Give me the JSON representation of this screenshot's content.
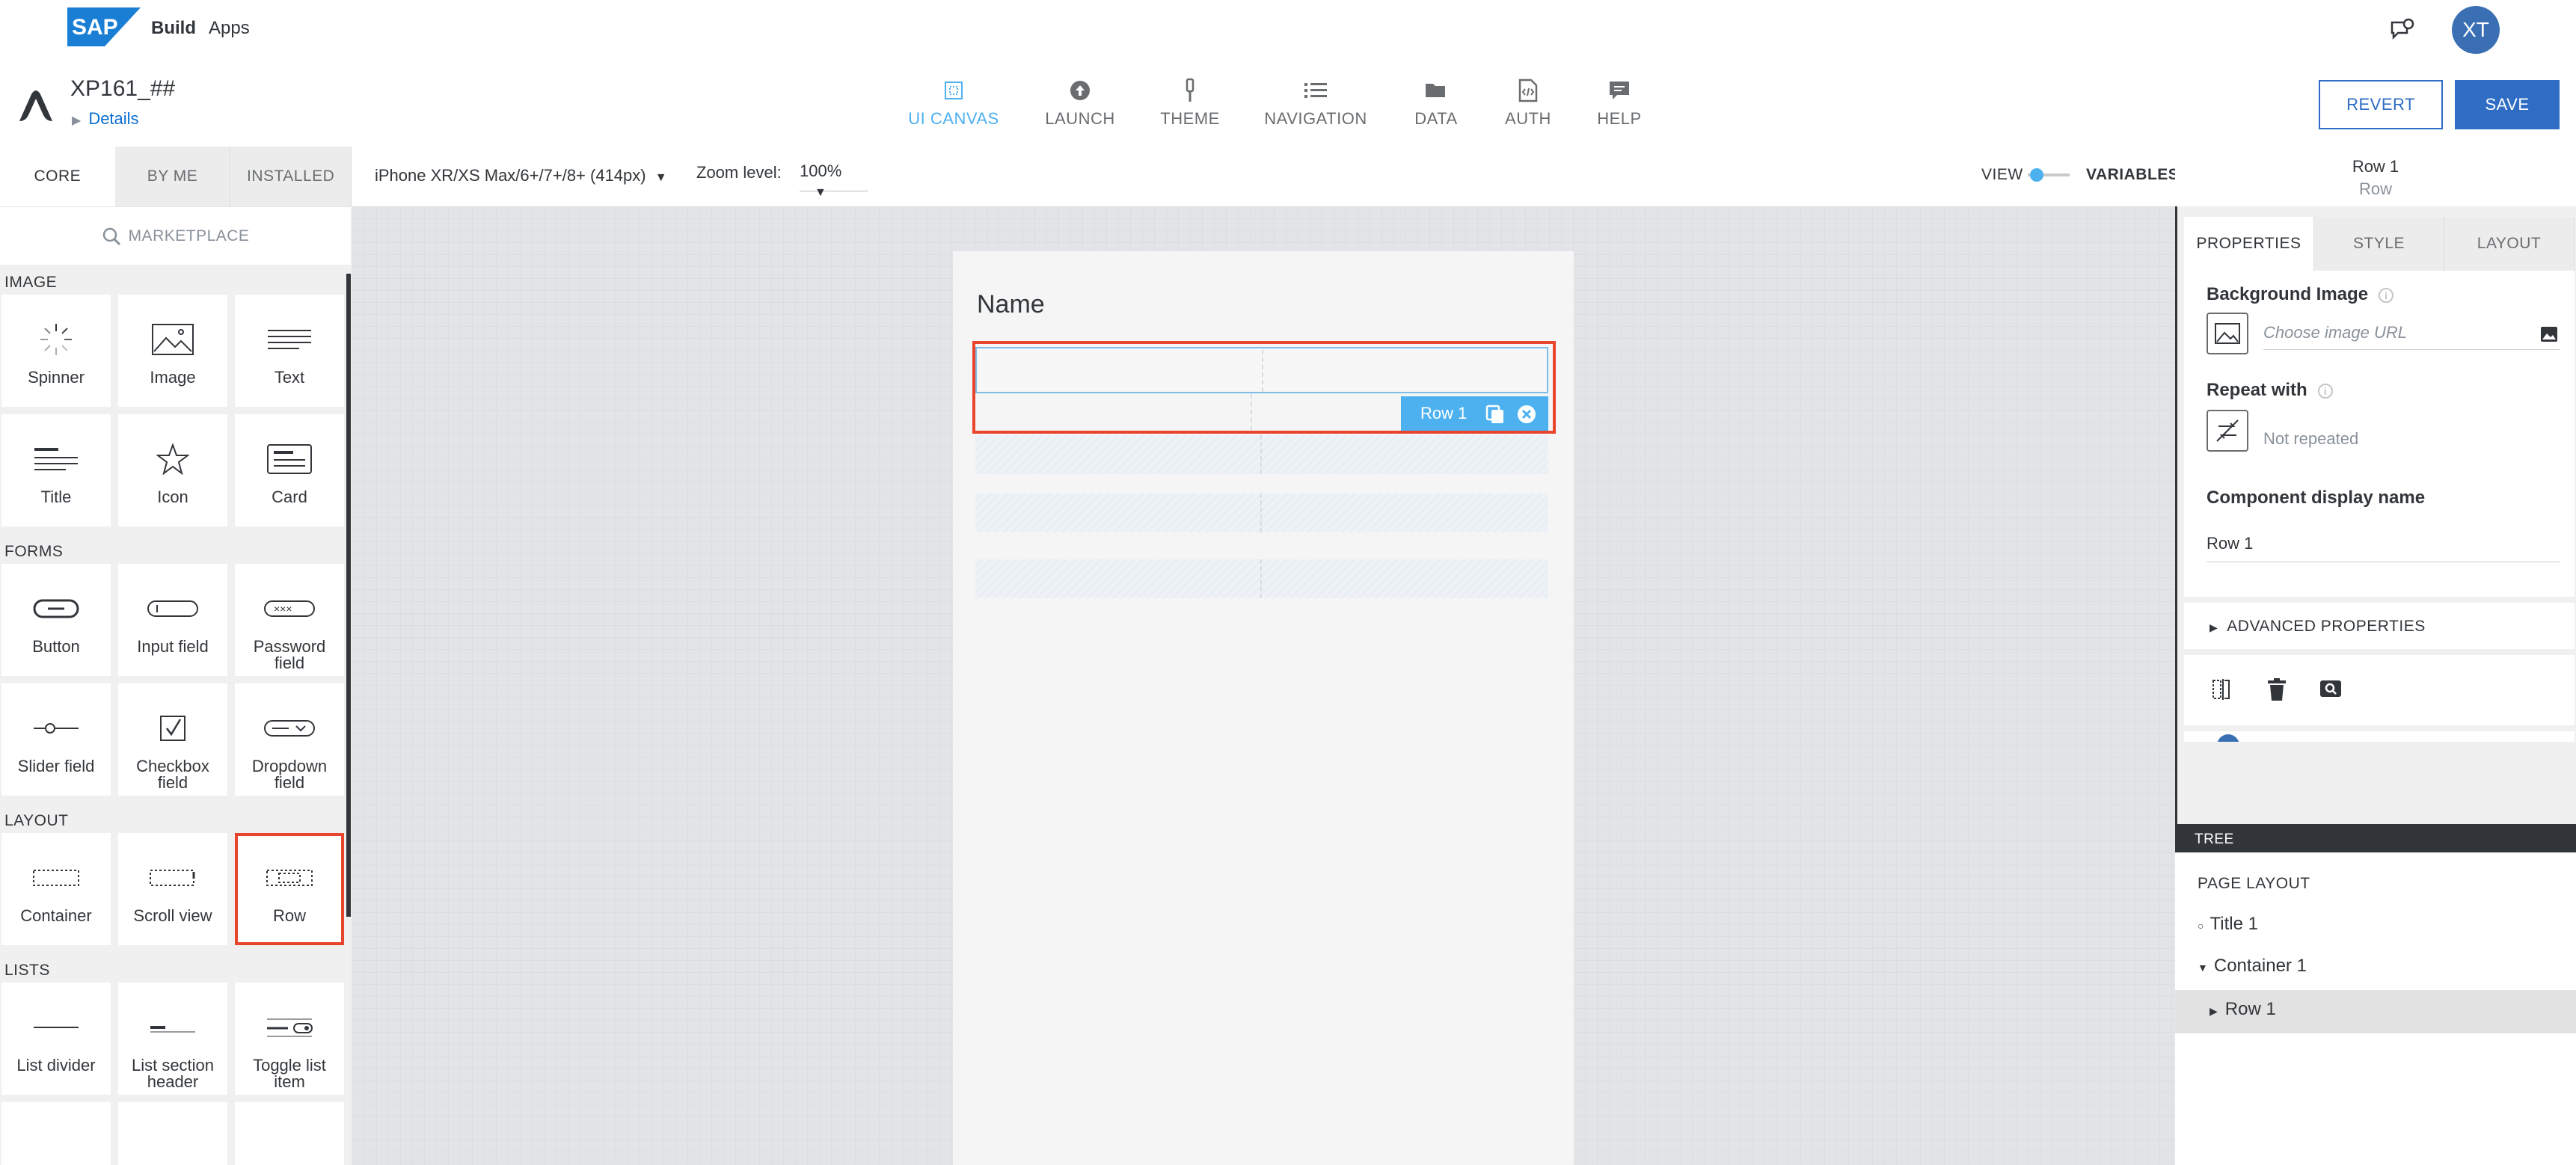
{
  "shell": {
    "brand": "SAP",
    "product_bold": "Build",
    "product": "Apps",
    "avatar_initials": "XT",
    "feedback_icon": "feedback-icon"
  },
  "app": {
    "name": "XP161_##",
    "details_link": "Details",
    "nav": [
      {
        "label": "UI CANVAS",
        "icon": "ui-canvas-icon",
        "active": true
      },
      {
        "label": "LAUNCH",
        "icon": "launch-icon",
        "active": false
      },
      {
        "label": "THEME",
        "icon": "theme-icon",
        "active": false
      },
      {
        "label": "NAVIGATION",
        "icon": "navigation-icon",
        "active": false
      },
      {
        "label": "DATA",
        "icon": "data-icon",
        "active": false
      },
      {
        "label": "AUTH",
        "icon": "auth-icon",
        "active": false
      },
      {
        "label": "HELP",
        "icon": "help-icon",
        "active": false
      }
    ],
    "revert_label": "REVERT",
    "save_label": "SAVE",
    "accent_color": "#2f6dc4",
    "active_color": "#4db1f0",
    "highlight_color": "#e8452c"
  },
  "palette": {
    "tabs": [
      "CORE",
      "BY ME",
      "INSTALLED"
    ],
    "marketplace": "MARKETPLACE",
    "sections": {
      "image": {
        "title": "IMAGE",
        "items": [
          "Spinner",
          "Image",
          "Text",
          "Title",
          "Icon",
          "Card"
        ]
      },
      "forms": {
        "title": "FORMS",
        "items": [
          "Button",
          "Input field",
          "Password field",
          "Slider field",
          "Checkbox field",
          "Dropdown field"
        ]
      },
      "layout": {
        "title": "LAYOUT",
        "items": [
          "Container",
          "Scroll view",
          "Row"
        ]
      },
      "lists": {
        "title": "LISTS",
        "items": [
          "List divider",
          "List section header",
          "Toggle list item"
        ]
      }
    }
  },
  "canvas": {
    "device": "iPhone XR/XS Max/6+/7+/8+ (414px)",
    "zoom_label": "Zoom level:",
    "zoom_value": "100%",
    "view_label": "VIEW",
    "variables_label": "VARIABLES",
    "page_title": "Name",
    "selected_badge": "Row 1"
  },
  "properties": {
    "selected_name": "Row 1",
    "selected_type": "Row",
    "tabs": [
      "PROPERTIES",
      "STYLE",
      "LAYOUT"
    ],
    "background_image_label": "Background Image",
    "image_url_placeholder": "Choose image URL",
    "repeat_with_label": "Repeat with",
    "repeat_value": "Not repeated",
    "display_name_label": "Component display name",
    "display_name_value": "Row 1",
    "advanced": "ADVANCED PROPERTIES"
  },
  "tree": {
    "header": "TREE",
    "root": "PAGE LAYOUT",
    "nodes": [
      "Title 1",
      "Container 1",
      "Row 1"
    ]
  }
}
